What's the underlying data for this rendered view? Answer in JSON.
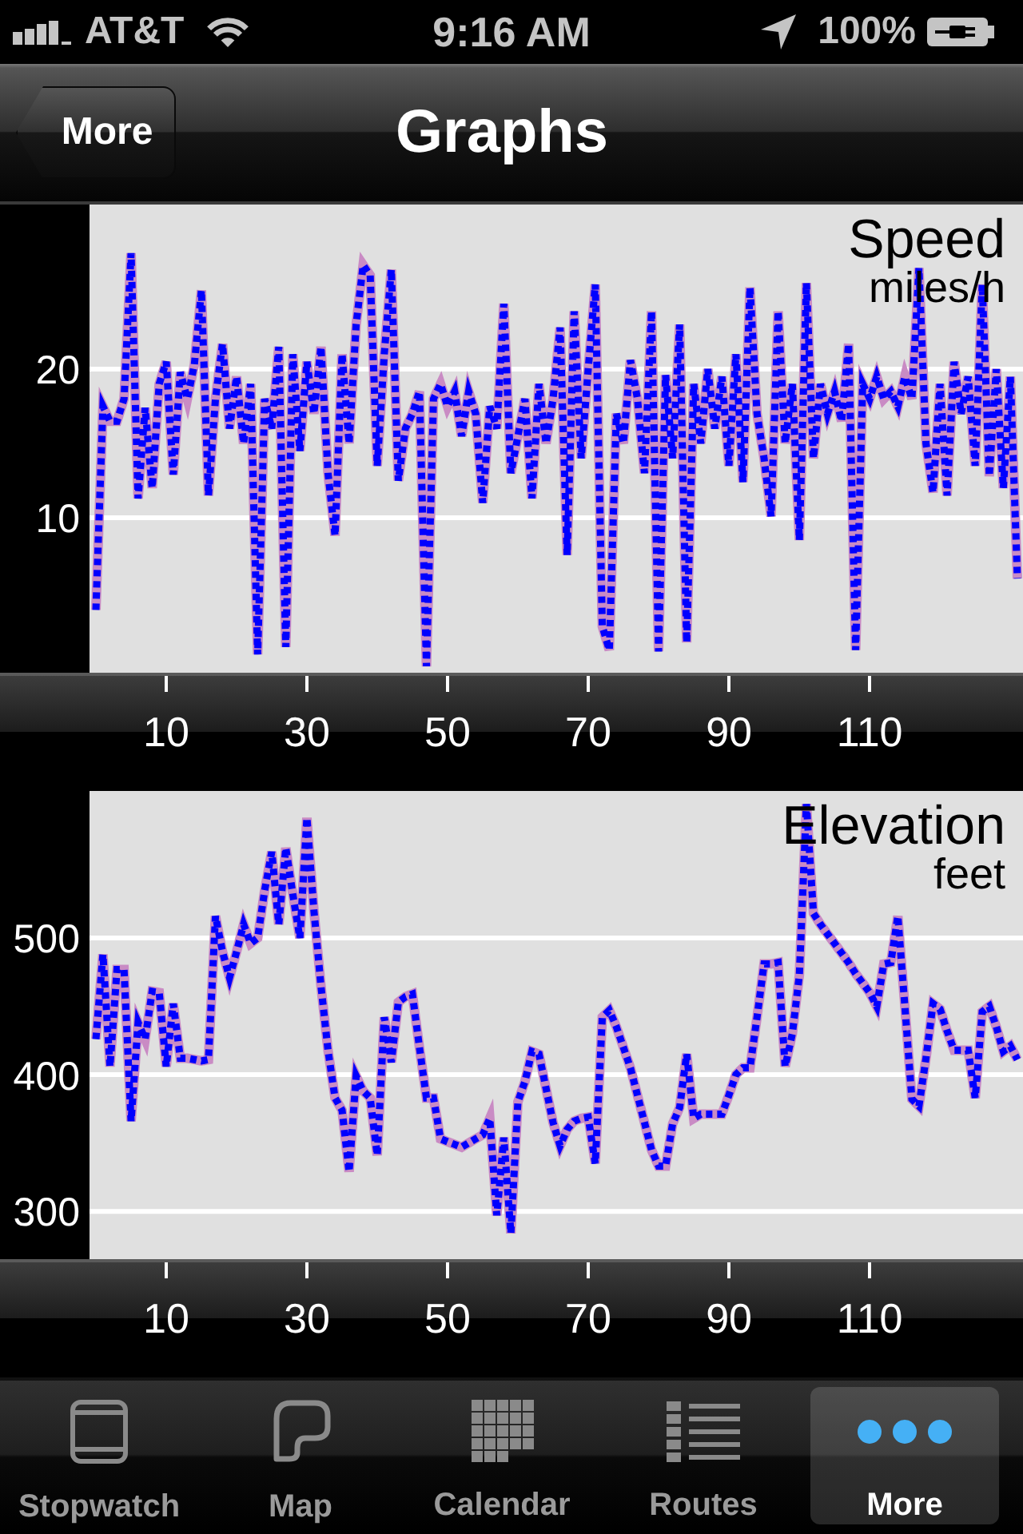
{
  "status_bar": {
    "carrier": "AT&T",
    "time": "9:16 AM",
    "battery": "100%"
  },
  "nav_bar": {
    "back_button": "More",
    "title": "Graphs"
  },
  "charts": [
    {
      "chart_data": {
        "type": "line",
        "title": "Speed",
        "ylabel": "miles/h",
        "x": [
          0,
          1,
          2,
          3,
          4,
          5,
          6,
          7,
          8,
          9,
          10,
          11,
          12,
          13,
          14,
          15,
          16,
          17,
          18,
          19,
          20,
          21,
          22,
          23,
          24,
          25,
          26,
          27,
          28,
          29,
          30,
          31,
          32,
          33,
          34,
          35,
          36,
          37,
          38,
          39,
          40,
          41,
          42,
          43,
          44,
          45,
          46,
          47,
          48,
          49,
          50,
          51,
          52,
          53,
          54,
          55,
          56,
          57,
          58,
          59,
          60,
          61,
          62,
          63,
          64,
          65,
          66,
          67,
          68,
          69,
          70,
          71,
          72,
          73,
          74,
          75,
          76,
          77,
          78,
          79,
          80,
          81,
          82,
          83,
          84,
          85,
          86,
          87,
          88,
          89,
          90,
          91,
          92,
          93,
          94,
          95,
          96,
          97,
          98,
          99,
          100,
          101,
          102,
          103,
          104,
          105,
          106,
          107,
          108,
          109,
          110,
          111,
          112,
          113,
          114,
          115,
          116,
          117,
          118,
          119,
          120,
          121,
          122,
          123,
          124,
          125,
          126,
          127,
          128,
          129,
          130,
          131
        ],
        "series": [
          {
            "color": "#0000ff",
            "line_style": "dashed",
            "values": [
              3.8,
              17.5,
              16.5,
              16.5,
              18,
              27.8,
              11.3,
              17.4,
              12,
              19,
              20.5,
              12.9,
              19.8,
              18,
              20.3,
              25.3,
              11.5,
              18,
              21.7,
              16,
              19.5,
              15,
              19,
              0.8,
              18,
              16,
              21.5,
              1.3,
              21,
              14.5,
              20.5,
              17,
              21.5,
              13,
              8.8,
              21,
              15,
              23,
              27,
              26.3,
              13.5,
              21,
              26.7,
              12.5,
              16,
              17,
              18.5,
              0,
              18,
              19,
              17.5,
              18.5,
              15.5,
              18.5,
              17,
              11,
              17.5,
              16,
              24.4,
              13,
              15.5,
              18,
              11.3,
              19,
              15,
              18,
              22.8,
              7.5,
              23.9,
              14,
              20,
              25.7,
              2.7,
              1.1,
              17,
              15,
              20.6,
              18,
              13,
              23.9,
              1,
              19.6,
              14,
              23,
              1.6,
              19,
              15,
              20,
              16,
              19.5,
              13.5,
              21,
              12.4,
              25.5,
              17,
              14,
              10.1,
              23.9,
              15,
              19,
              8.5,
              25.8,
              14,
              19,
              17,
              18.5,
              16.5,
              21.7,
              1.1,
              19,
              18,
              19.5,
              18,
              18.5,
              17.5,
              19.5,
              18,
              26.8,
              15,
              11.7,
              19,
              11.5,
              20.5,
              17,
              19.5,
              13.5,
              25.7,
              12.8,
              20,
              12,
              19.5,
              5.9
            ]
          }
        ],
        "xlim": [
          -0.9,
          131.8
        ],
        "ylim": [
          -0.43,
          31.08
        ],
        "xticks": [
          10,
          30,
          50,
          70,
          90,
          110
        ],
        "yticks": [
          10,
          20
        ],
        "grid": true
      }
    },
    {
      "chart_data": {
        "type": "line",
        "title": "Elevation",
        "ylabel": "feet",
        "x": [
          0,
          1,
          2,
          3,
          4,
          5,
          6,
          7,
          8,
          9,
          10,
          11,
          12,
          13,
          14,
          15,
          16,
          17,
          18,
          19,
          20,
          21,
          22,
          23,
          24,
          25,
          26,
          27,
          28,
          29,
          30,
          31,
          32,
          33,
          34,
          35,
          36,
          37,
          38,
          39,
          40,
          41,
          42,
          43,
          44,
          45,
          46,
          47,
          48,
          49,
          50,
          51,
          52,
          53,
          54,
          55,
          56,
          57,
          58,
          59,
          60,
          61,
          62,
          63,
          64,
          65,
          66,
          67,
          68,
          69,
          70,
          71,
          72,
          73,
          74,
          75,
          76,
          77,
          78,
          79,
          80,
          81,
          82,
          83,
          84,
          85,
          86,
          87,
          88,
          89,
          90,
          91,
          92,
          93,
          94,
          95,
          96,
          97,
          98,
          99,
          100,
          101,
          102,
          103,
          104,
          105,
          106,
          107,
          108,
          109,
          110,
          111,
          112,
          113,
          114,
          115,
          116,
          117,
          118,
          119,
          120,
          121,
          122,
          123,
          124,
          125,
          126,
          127,
          128,
          129,
          130,
          131
        ],
        "series": [
          {
            "color": "#0000ff",
            "line_style": "dashed",
            "values": [
              426,
              488,
              406,
              477,
              477,
              366,
              438,
              426,
              461,
              460,
              406,
              452,
              412,
              412,
              411,
              410,
              411,
              516,
              490,
              471,
              490,
              510,
              496,
              500,
              535,
              563,
              510,
              566,
              532,
              500,
              588,
              520,
              465,
              418,
              383,
              374,
              329,
              399,
              388,
              383,
              341,
              442,
              409,
              453,
              457,
              459,
              420,
              383,
              383,
              353,
              351,
              349,
              347,
              350,
              353,
              356,
              368,
              297,
              354,
              284,
              380,
              395,
              417,
              415,
              390,
              365,
              348,
              360,
              366,
              368,
              369,
              335,
              442,
              447,
              435,
              420,
              405,
              385,
              365,
              345,
              333,
              333,
              364,
              376,
              415,
              368,
              371,
              371,
              371,
              371,
              385,
              400,
              405,
              405,
              442,
              481,
              481,
              482,
              406,
              430,
              473,
              598,
              518,
              510,
              503,
              496,
              489,
              482,
              474,
              467,
              460,
              450,
              481,
              482,
              516,
              450,
              382,
              377,
              412,
              452,
              448,
              432,
              418,
              418,
              418,
              383,
              446,
              450,
              435,
              417,
              421,
              411
            ]
          }
        ],
        "xlim": [
          -0.9,
          131.8
        ],
        "ylim": [
          265,
          607.6
        ],
        "xticks": [
          10,
          30,
          50,
          70,
          90,
          110
        ],
        "yticks": [
          300,
          400,
          500
        ],
        "grid": true
      }
    }
  ],
  "tab_bar": {
    "tabs": [
      {
        "label": "Stopwatch",
        "selected": false
      },
      {
        "label": "Map",
        "selected": false
      },
      {
        "label": "Calendar",
        "selected": false
      },
      {
        "label": "Routes",
        "selected": false
      },
      {
        "label": "More",
        "selected": true
      }
    ]
  }
}
